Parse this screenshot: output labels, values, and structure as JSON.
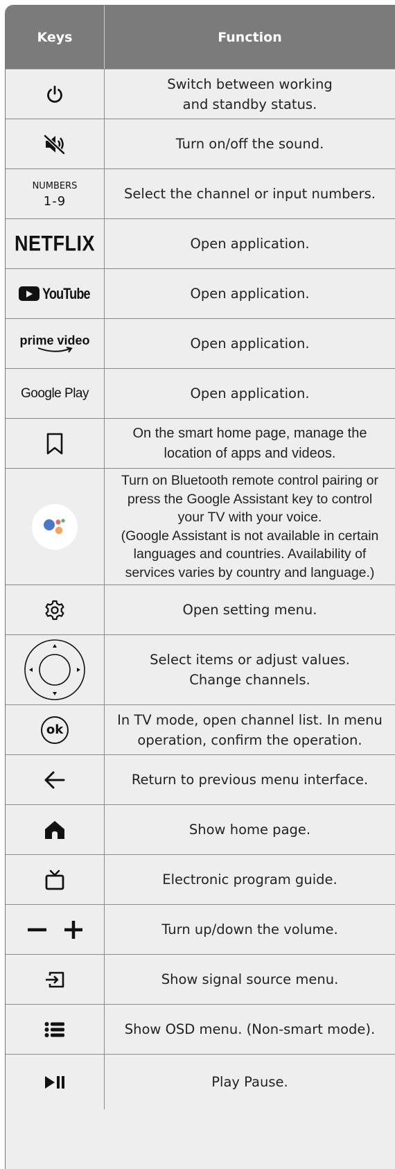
{
  "header": {
    "keys": "Keys",
    "function": "Function"
  },
  "rows": [
    {
      "key_name": "power-icon",
      "function": "Switch between working\nand standby status."
    },
    {
      "key_name": "mute-icon",
      "function": "Turn on/off the sound."
    },
    {
      "key_name": "numbers-key",
      "key_label": "NUMBERS",
      "key_sub": "1-9",
      "function": "Select the channel or input numbers."
    },
    {
      "key_name": "netflix-logo",
      "key_label": "NETFLIX",
      "function": "Open application."
    },
    {
      "key_name": "youtube-logo",
      "key_label": "YouTube",
      "function": "Open application."
    },
    {
      "key_name": "prime-video-logo",
      "key_label": "prime video",
      "function": "Open application."
    },
    {
      "key_name": "google-play-logo",
      "key_label": "Google Play",
      "function": "Open application."
    },
    {
      "key_name": "bookmark-icon",
      "function": "On the smart home page, manage the\nlocation of apps and videos."
    },
    {
      "key_name": "google-assistant-icon",
      "function": "Turn on Bluetooth remote control pairing or\npress the Google Assistant key to control\nyour TV with your voice.\n(Google Assistant is not available in certain\nlanguages and countries. Availability of\nservices varies by country and language.)"
    },
    {
      "key_name": "settings-gear-icon",
      "function": "Open setting menu."
    },
    {
      "key_name": "dpad-icon",
      "function": "Select items or adjust values.\nChange channels."
    },
    {
      "key_name": "ok-icon",
      "key_label": "ok",
      "function": "In TV mode, open channel list. In menu\noperation, confirm the operation."
    },
    {
      "key_name": "back-arrow-icon",
      "function": "Return to previous menu interface."
    },
    {
      "key_name": "home-icon",
      "function": "Show home page."
    },
    {
      "key_name": "tv-guide-icon",
      "function": "Electronic program guide."
    },
    {
      "key_name": "volume-minus-plus-icon",
      "function": "Turn up/down the volume."
    },
    {
      "key_name": "input-source-icon",
      "function": "Show signal source menu."
    },
    {
      "key_name": "menu-list-icon",
      "function": "Show OSD menu. (Non-smart mode)."
    },
    {
      "key_name": "play-pause-icon",
      "function": "Play Pause."
    }
  ],
  "colors": {
    "header_bg": "#7b7b7b",
    "row_bg": "#eeeeee",
    "border": "#8a8a8a",
    "text": "#222222"
  }
}
